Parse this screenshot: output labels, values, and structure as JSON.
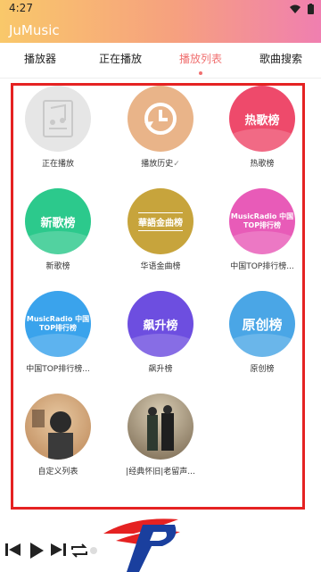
{
  "status": {
    "time": "4:27"
  },
  "app": {
    "title": "JuMusic"
  },
  "tabs": [
    {
      "label": "播放器"
    },
    {
      "label": "正在播放"
    },
    {
      "label": "播放列表",
      "active": true
    },
    {
      "label": "歌曲搜索"
    }
  ],
  "playlists": [
    {
      "label": "正在播放",
      "cover_text": "",
      "color": "#e6e6e6",
      "icon": "music-file-icon"
    },
    {
      "label": "播放历史",
      "cover_text": "",
      "color": "#e9b489",
      "icon": "history-icon"
    },
    {
      "label": "热歌榜",
      "cover_text": "热歌榜",
      "color": "#ee4a6b"
    },
    {
      "label": "新歌榜",
      "cover_text": "新歌榜",
      "color": "#2cc98c"
    },
    {
      "label": "华语金曲榜",
      "cover_text": "華語金曲榜",
      "color": "#c7a43c"
    },
    {
      "label": "中国TOP排行榜...",
      "cover_text": "MusicRadio 中国TOP排行榜",
      "color": "#e85bb8"
    },
    {
      "label": "中国TOP排行榜...",
      "cover_text": "MusicRadio 中国TOP排行榜",
      "color": "#3aa3ec"
    },
    {
      "label": "飙升榜",
      "cover_text": "飙升榜",
      "color": "#6d4ee0"
    },
    {
      "label": "原创榜",
      "cover_text": "原创榜",
      "color": "#4aa6e6"
    },
    {
      "label": "自定义列表",
      "cover_text": "",
      "color": "#c99a6d",
      "icon": "photo-cover-icon"
    },
    {
      "label": "|经典怀旧|老留声...",
      "cover_text": "",
      "color": "#8a7a62",
      "icon": "photo-cover-icon"
    }
  ],
  "player": {
    "controls": [
      "previous-icon",
      "play-icon",
      "next-icon",
      "repeat-icon"
    ]
  }
}
